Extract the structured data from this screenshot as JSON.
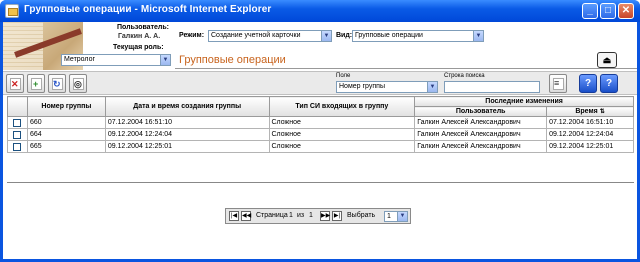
{
  "window": {
    "title": "Групповые операции - Microsoft Internet Explorer",
    "minimize": "_",
    "maximize": "□",
    "close": "✕"
  },
  "user": {
    "user_label": "Пользователь:",
    "user_name": "Галкин А. А.",
    "role_label": "Текущая роль:",
    "role_value": "Метролог"
  },
  "filters": {
    "mode_label": "Режим:",
    "mode_value": "Создание учетной карточки",
    "view_label": "Вид:",
    "view_value": "Групповые операции"
  },
  "page": {
    "heading": "Групповые операции"
  },
  "search": {
    "field_label": "Поле",
    "field_value": "Номер группы",
    "query_label": "Строка поиска",
    "query_value": ""
  },
  "help": {
    "help_label": "?",
    "help2_label": "?"
  },
  "table": {
    "headers": {
      "group_number": "Номер группы",
      "created": "Дата и время создания группы",
      "type": "Тип СИ входящих в группу",
      "last_changes": "Последние изменения",
      "user": "Пользователь",
      "time": "Время"
    },
    "rows": [
      {
        "group_number": "660",
        "created": "07.12.2004 16:51:10",
        "type": "Сложное",
        "user": "Галкин Алексей Александрович",
        "time": "07.12.2004 16:51:10"
      },
      {
        "group_number": "664",
        "created": "09.12.2004 12:24:04",
        "type": "Сложное",
        "user": "Галкин Алексей Александрович",
        "time": "09.12.2004 12:24:04"
      },
      {
        "group_number": "665",
        "created": "09.12.2004 12:25:01",
        "type": "Сложное",
        "user": "Галкин Алексей Александрович",
        "time": "09.12.2004 12:25:01"
      }
    ]
  },
  "pager": {
    "page_label": "Страница",
    "current_page": "1",
    "of_label": "из",
    "total_pages": "1",
    "select_label": "Выбрать",
    "select_value": "1"
  },
  "colors": {
    "heading": "#c8641e",
    "titlebar": "#0a5ae6"
  }
}
